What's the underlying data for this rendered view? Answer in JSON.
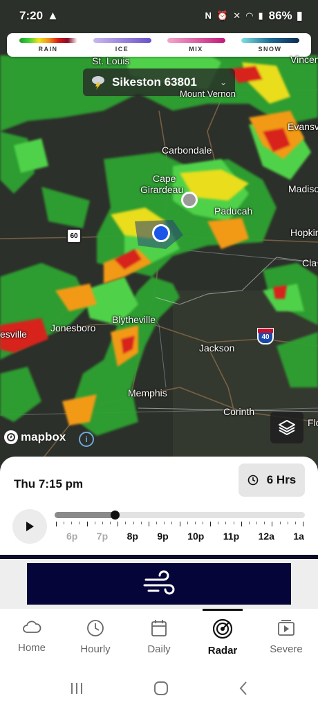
{
  "status_bar": {
    "time": "7:20",
    "battery": "86%"
  },
  "legend": [
    {
      "label": "RAIN",
      "gradient": "linear-gradient(90deg,#1e9e2a,#3fd13a,#f1e21c,#f29418,#d91a14,#8a0b24,#fff)"
    },
    {
      "label": "ICE",
      "gradient": "linear-gradient(90deg,#c9b8ef,#6a52c9)"
    },
    {
      "label": "MIX",
      "gradient": "linear-gradient(90deg,#f3a7cb,#c2187a)"
    },
    {
      "label": "SNOW",
      "gradient": "linear-gradient(90deg,#7fe0e3,#1b6a93,#0e2a55)"
    }
  ],
  "location": {
    "name": "Sikeston 63801"
  },
  "map": {
    "cities": {
      "st_louis": "St. Louis",
      "mt_vernon": "Mount Vernon",
      "vincennes": "Vincen",
      "evansville": "Evansv",
      "carbondale": "Carbondale",
      "cape_girardeau_1": "Cape",
      "cape_girardeau_2": "Girardeau",
      "madisonville": "Madiso",
      "paducah": "Paducah",
      "hopkinsville": "Hopkin",
      "clarksville": "Cla",
      "blytheville": "Blytheville",
      "jonesboro": "Jonesboro",
      "batesville": "esville",
      "jackson": "Jackson",
      "memphis": "Memphis",
      "corinth": "Corinth",
      "florence": "Flo"
    },
    "highways": {
      "us60": "60",
      "i40": "40"
    },
    "attribution": "mapbox",
    "info": "i"
  },
  "timeline": {
    "current_time": "Thu 7:15 pm",
    "duration": "6 Hrs",
    "progress_fraction": 0.24,
    "hours": [
      {
        "label": "6p",
        "past": true
      },
      {
        "label": "7p",
        "past": true
      },
      {
        "label": "8p",
        "past": false
      },
      {
        "label": "9p",
        "past": false
      },
      {
        "label": "10p",
        "past": false
      },
      {
        "label": "11p",
        "past": false
      },
      {
        "label": "12a",
        "past": false
      },
      {
        "label": "1a",
        "past": false
      }
    ]
  },
  "nav": [
    {
      "label": "Home",
      "icon": "cloud-icon",
      "active": false
    },
    {
      "label": "Hourly",
      "icon": "clock-icon",
      "active": false
    },
    {
      "label": "Daily",
      "icon": "calendar-icon",
      "active": false
    },
    {
      "label": "Radar",
      "icon": "radar-icon",
      "active": true
    },
    {
      "label": "Severe",
      "icon": "play-alert-icon",
      "active": false
    }
  ],
  "colors": {
    "accent": "#111111",
    "marker_blue": "#1a56e8",
    "banner_bg": "#05053a"
  }
}
